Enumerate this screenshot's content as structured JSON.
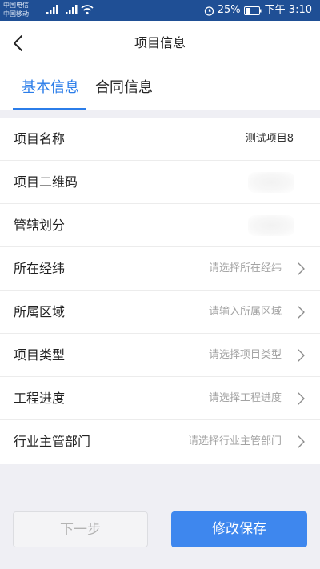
{
  "status_bar": {
    "carrier_1": "中国电信",
    "carrier_2": "中国移动",
    "battery": "25%",
    "time": "下午 3:10"
  },
  "nav": {
    "title": "项目信息"
  },
  "tabs": [
    {
      "label": "基本信息",
      "active": true
    },
    {
      "label": "合同信息",
      "active": false
    }
  ],
  "form": {
    "rows": [
      {
        "label": "项目名称",
        "value": "测试项目8"
      },
      {
        "label": "项目二维码"
      },
      {
        "label": "管辖划分"
      },
      {
        "label": "所在经纬",
        "placeholder": "请选择所在经纬"
      },
      {
        "label": "所属区域",
        "placeholder": "请输入所属区域"
      },
      {
        "label": "项目类型",
        "placeholder": "请选择项目类型"
      },
      {
        "label": "工程进度",
        "placeholder": "请选择工程进度"
      },
      {
        "label": "行业主管部门",
        "placeholder": "请选择行业主管部门"
      }
    ]
  },
  "buttons": {
    "prev": "下一步",
    "save": "修改保存"
  },
  "colors": {
    "accent": "#2b7de9",
    "save_button": "#3e87ee",
    "status_bar": "#1f4f95",
    "background": "#efeff4"
  },
  "icons": {
    "back": "back-arrow-icon",
    "chevron": "chevron-right-icon",
    "signal": "signal-icon",
    "wifi": "wifi-icon",
    "alarm": "alarm-icon",
    "battery": "battery-icon"
  }
}
